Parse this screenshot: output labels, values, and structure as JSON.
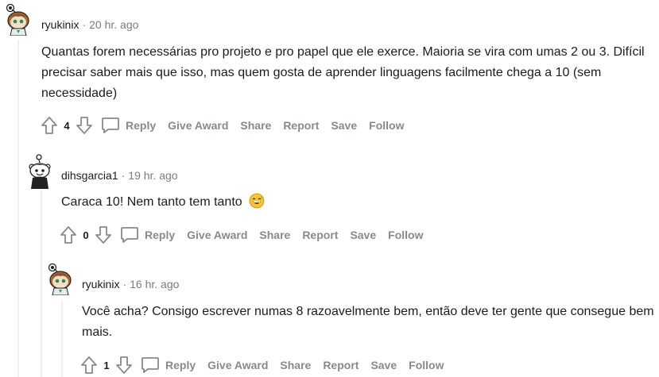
{
  "colors": {
    "meta": "#7c7c7c",
    "action": "#878a8c",
    "thread_line": "#edeff1",
    "text": "#1c1c1c"
  },
  "icons": {
    "upvote": "arrow-up-icon",
    "downvote": "arrow-down-icon",
    "reply": "speech-bubble-icon",
    "emoji": "grinning-sweat-emoji"
  },
  "comments": [
    {
      "author": "ryukinix",
      "time": "20 hr. ago",
      "body": "Quantas forem necessárias pro projeto e pro papel que ele exerce. Maioria se vira com umas 2 ou 3. Difícil precisar saber mais que isso, mas quem gosta de aprender linguagens facilmente chega a 10 (sem necessidade)",
      "score": "4",
      "actions": {
        "reply": "Reply",
        "award": "Give Award",
        "share": "Share",
        "report": "Report",
        "save": "Save",
        "follow": "Follow"
      }
    },
    {
      "author": "dihsgarcia1",
      "time": "19 hr. ago",
      "body": "Caraca 10! Nem tanto tem tanto",
      "emoji": "😅",
      "score": "0",
      "actions": {
        "reply": "Reply",
        "award": "Give Award",
        "share": "Share",
        "report": "Report",
        "save": "Save",
        "follow": "Follow"
      }
    },
    {
      "author": "ryukinix",
      "time": "16 hr. ago",
      "body": "Você acha? Consigo escrever numas 8 razoavelmente bem, então deve ter gente que consegue bem mais.",
      "score": "1",
      "actions": {
        "reply": "Reply",
        "award": "Give Award",
        "share": "Share",
        "report": "Report",
        "save": "Save",
        "follow": "Follow"
      }
    }
  ]
}
